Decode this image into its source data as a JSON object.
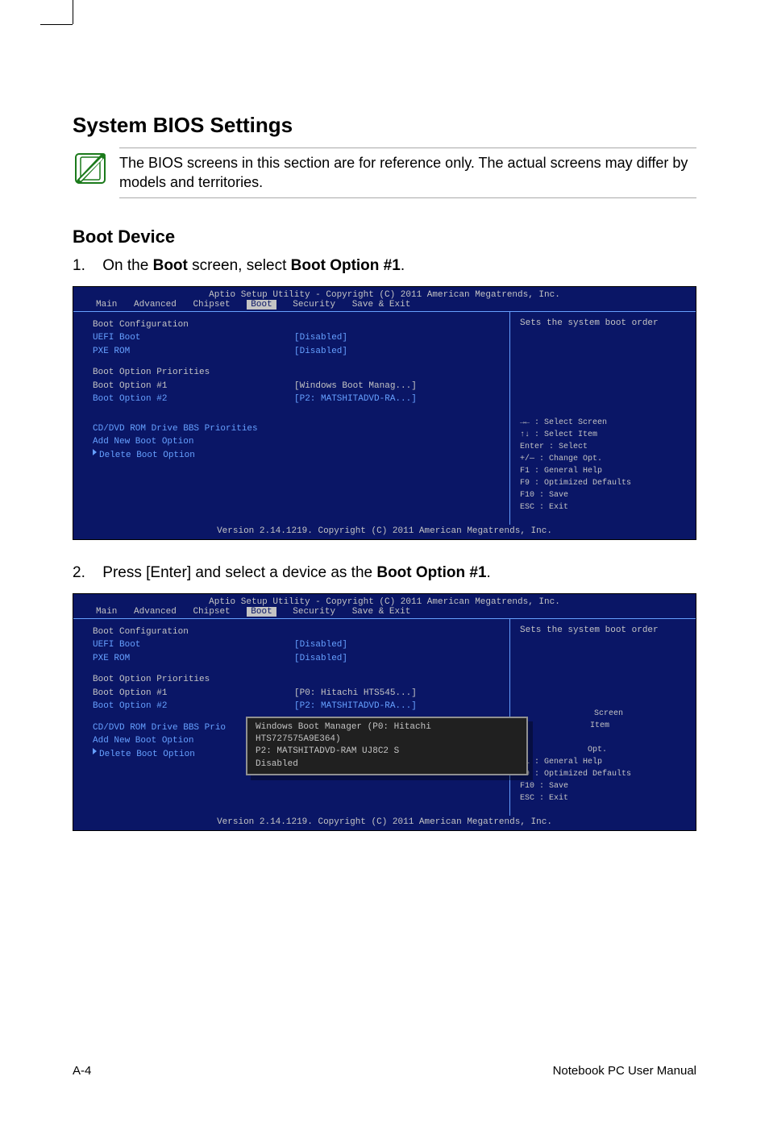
{
  "heading": "System BIOS Settings",
  "note": "The BIOS screens in this section are for reference only. The actual screens may differ by models and territories.",
  "subheading": "Boot Device",
  "step1_num": "1.",
  "step1_pre": "On the ",
  "step1_b1": "Boot",
  "step1_mid": " screen, select ",
  "step1_b2": "Boot Option #1",
  "step1_post": ".",
  "step2_num": "2.",
  "step2_pre": "Press [Enter] and select a device as the ",
  "step2_b1": "Boot Option #1",
  "step2_post": ".",
  "bios_common": {
    "title": "Aptio Setup Utility - Copyright (C) 2011 American Megatrends, Inc.",
    "tabs": {
      "main": "Main",
      "advanced": "Advanced",
      "chipset": "Chipset",
      "boot": "Boot",
      "security": "Security",
      "save": "Save & Exit"
    },
    "hint": "Sets the system boot order",
    "boot_config": "Boot Configuration",
    "uefi_boot": "UEFI Boot",
    "pxe_rom": "PXE ROM",
    "disabled": "[Disabled]",
    "priorities": "Boot Option Priorities",
    "opt1_label": "Boot Option #1",
    "opt2_label": "Boot Option #2",
    "opt2_val": "[P2: MATSHITADVD-RA...]",
    "cd_prio": "CD/DVD ROM Drive BBS Priorities",
    "cd_prio_short": "CD/DVD ROM Drive BBS Prio",
    "add_opt": "Add New Boot Option",
    "del_opt": "Delete Boot Option",
    "footer": "Version 2.14.1219. Copyright (C) 2011 American Megatrends, Inc.",
    "keys": {
      "k1": "→← : Select Screen",
      "k2": "↑↓    : Select Item",
      "k3": "Enter : Select",
      "k4": "+/—  : Change Opt.",
      "k5": "F1    : General Help",
      "k6": "F9    : Optimized Defaults",
      "k7": "F10  : Save",
      "k8": "ESC  : Exit"
    },
    "keys_partial": {
      "kTop": "Screen",
      "kItem": "Item",
      "kOpt": " Opt."
    }
  },
  "bios1": {
    "opt1_val": "[Windows Boot Manag...]"
  },
  "bios2": {
    "opt1_val": "[P0:  Hitachi HTS545...]",
    "popup": {
      "line1": "Windows Boot Manager (P0: Hitachi HTS727575A9E364)",
      "line2": "P2: MATSHITADVD-RAM UJ8C2 S",
      "line3": "Disabled"
    }
  },
  "footer": {
    "left": "A-4",
    "right": "Notebook PC User Manual"
  }
}
